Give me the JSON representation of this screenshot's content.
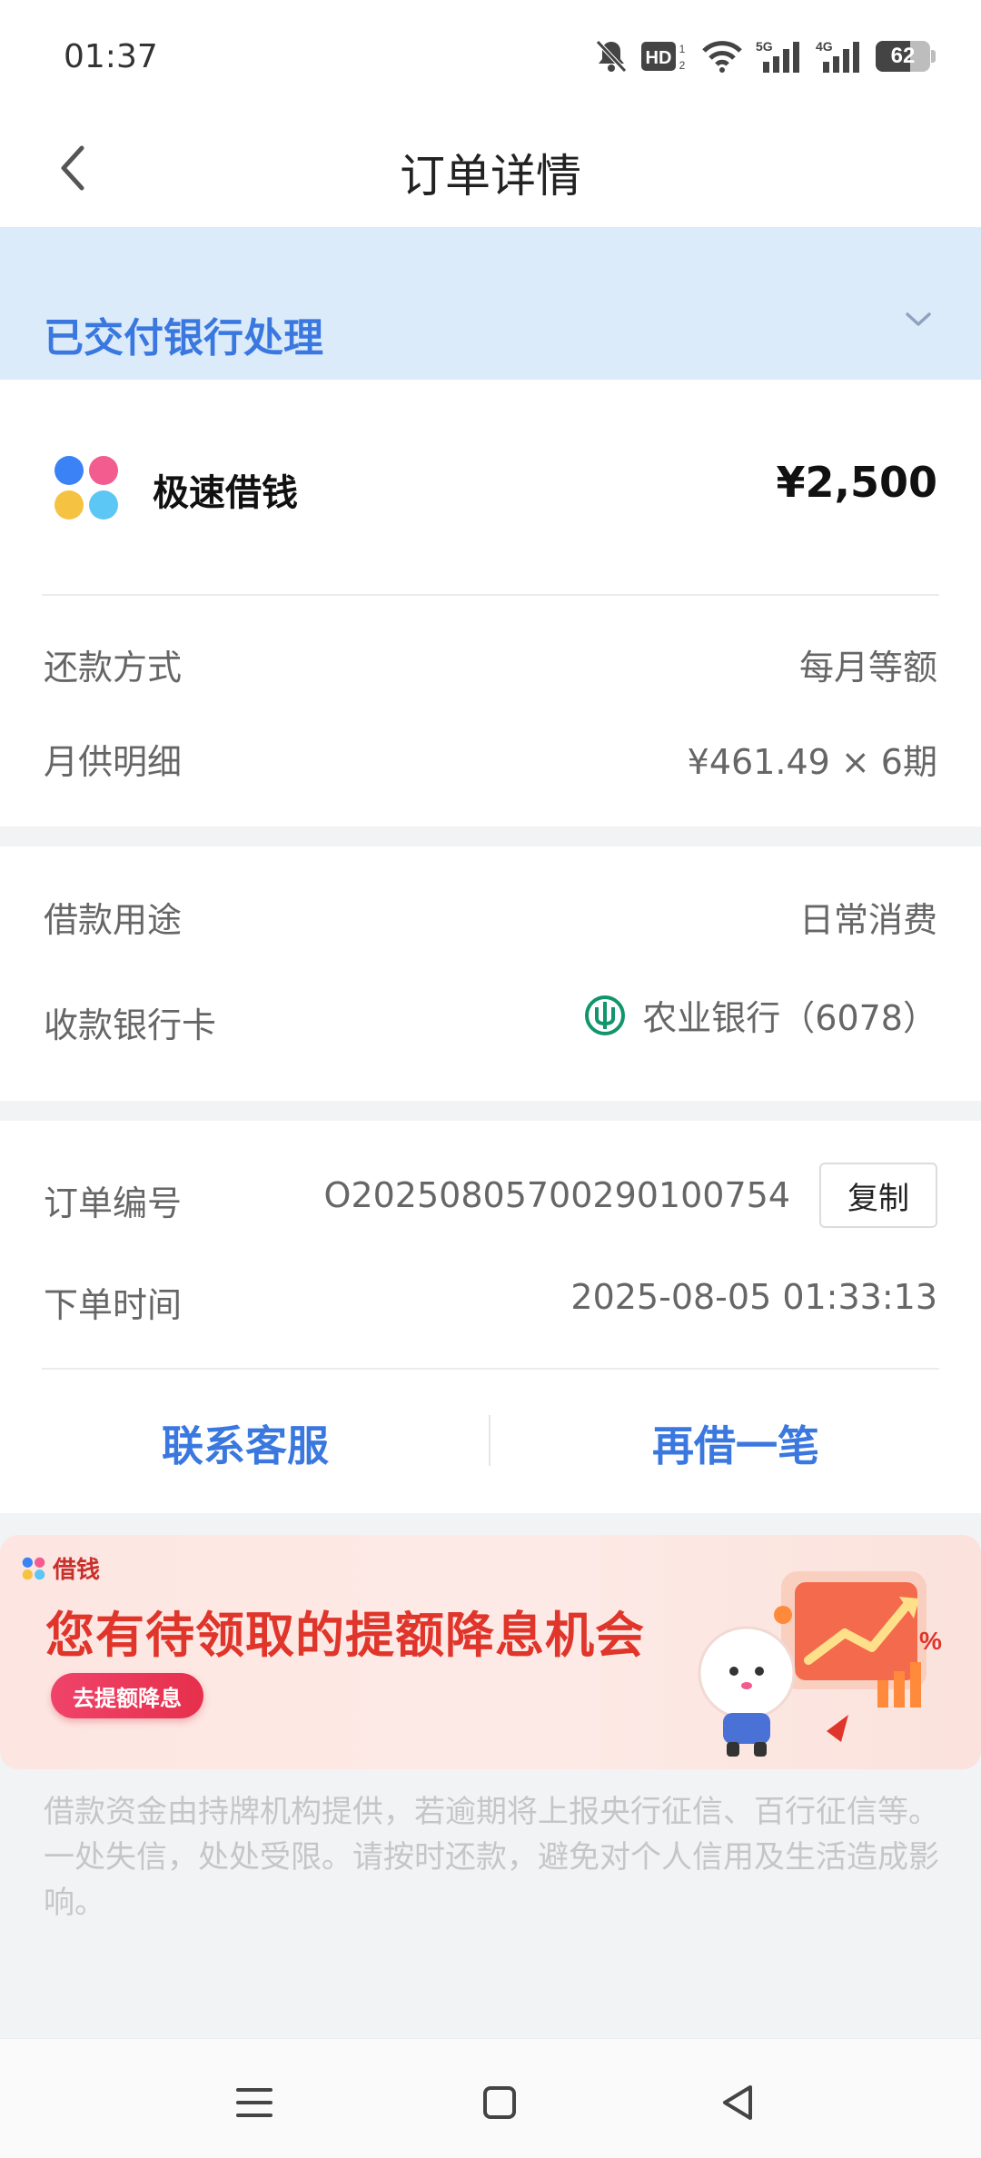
{
  "status_bar": {
    "time": "01:37",
    "battery": "62",
    "icons": [
      "mute-bell-icon",
      "hd-icon",
      "wifi-icon",
      "signal-5g-icon",
      "signal-4g-icon",
      "battery-icon"
    ]
  },
  "nav": {
    "title": "订单详情",
    "back_icon": "chevron-left-icon"
  },
  "order_status": {
    "text": "已交付银行处理",
    "expand_icon": "chevron-down-icon",
    "banner_color": "#dcebfa",
    "accent_color": "#3a78e0"
  },
  "product": {
    "name": "极速借钱",
    "amount": "¥2,500",
    "logo_icon": "four-petal-logo-icon"
  },
  "repayment": {
    "method_label": "还款方式",
    "method_value": "每月等额",
    "monthly_label": "月供明细",
    "monthly_value": "¥461.49 × 6期"
  },
  "loan": {
    "purpose_label": "借款用途",
    "purpose_value": "日常消费",
    "card_label": "收款银行卡",
    "card_value": "农业银行（6078）",
    "bank_icon": "abc-bank-logo-icon"
  },
  "order": {
    "id_label": "订单编号",
    "id_value": "O2025080570029010075​4",
    "copy_label": "复制",
    "time_label": "下单时间",
    "time_value": "2025-08-05 01:33:13"
  },
  "actions": {
    "contact": "联系客服",
    "borrow_again": "再借一笔"
  },
  "promo": {
    "brand": "借钱",
    "title": "您有待领取的提额降息机会",
    "button": "去提额降息"
  },
  "disclaimer": "借款资金由持牌机构提供，若逾期将上报央行征信、百行征信等。一处失信，处处受限。请按时还款，避免对个人信用及生活造成影响。",
  "system_nav": {
    "icons": [
      "menu-icon",
      "home-square-icon",
      "back-triangle-icon"
    ]
  }
}
